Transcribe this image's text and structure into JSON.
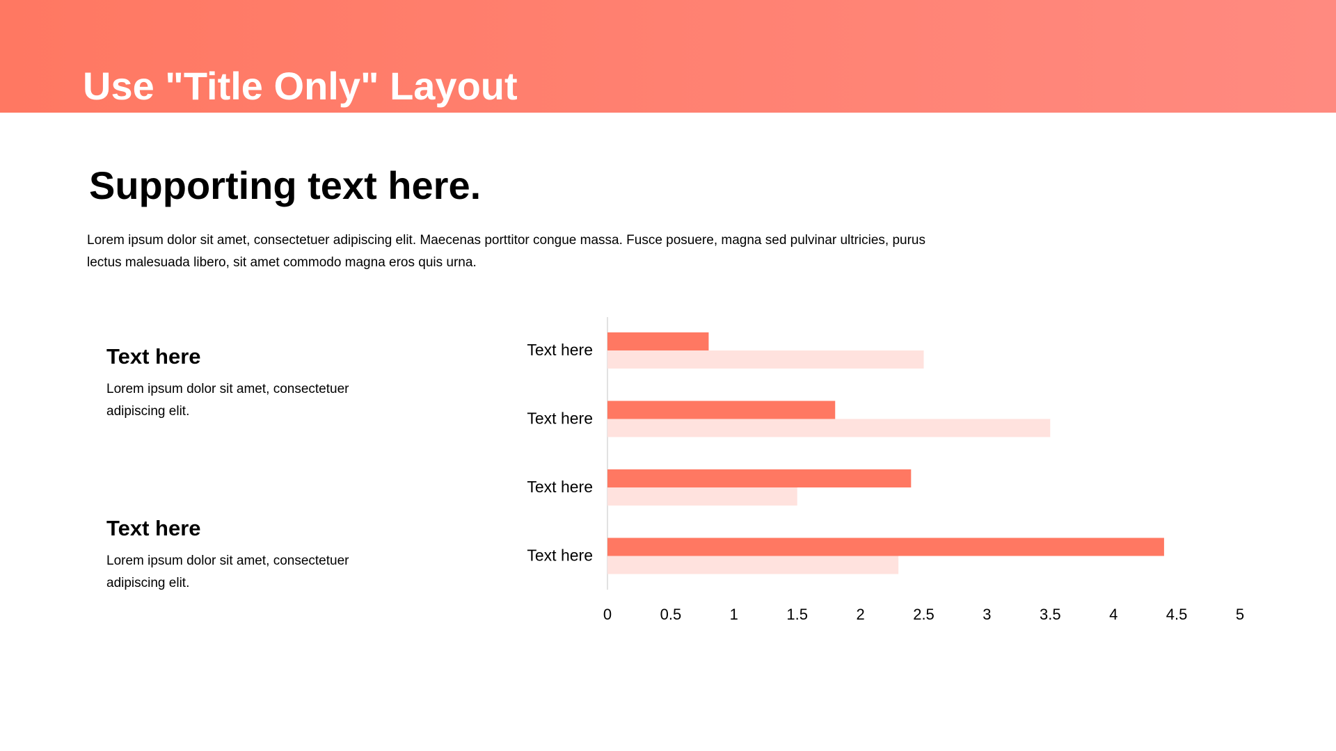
{
  "header": {
    "title": "Use \"Title Only\" Layout"
  },
  "main": {
    "supporting_title": "Supporting text here.",
    "paragraph": "Lorem ipsum dolor sit amet, consectetuer adipiscing elit. Maecenas porttitor congue massa. Fusce posuere, magna sed pulvinar ultricies, purus lectus malesuada libero, sit amet commodo magna eros quis urna."
  },
  "blocks": [
    {
      "heading": "Text here",
      "body": "Lorem ipsum dolor sit amet, consectetuer adipiscing elit."
    },
    {
      "heading": "Text here",
      "body": "Lorem ipsum dolor sit amet, consectetuer adipiscing elit."
    }
  ],
  "colors": {
    "accent": "#ff7862",
    "accent_light": "#ffe2de",
    "header_gradient_start": "#ff7862",
    "header_gradient_end": "#ff8a80"
  },
  "chart_data": {
    "type": "bar",
    "orientation": "horizontal",
    "categories": [
      "Text here",
      "Text here",
      "Text here",
      "Text here"
    ],
    "series": [
      {
        "values": [
          0.8,
          1.8,
          2.4,
          4.4
        ]
      },
      {
        "values": [
          2.5,
          3.5,
          1.5,
          2.3
        ]
      }
    ],
    "xlim": [
      0,
      5
    ],
    "x_ticks": [
      "0",
      "0.5",
      "1",
      "1.5",
      "2",
      "2.5",
      "3",
      "3.5",
      "4",
      "4.5",
      "5"
    ],
    "x_tick_values": [
      0,
      0.5,
      1,
      1.5,
      2,
      2.5,
      3,
      3.5,
      4,
      4.5,
      5
    ],
    "grid": false,
    "legend": "none"
  }
}
